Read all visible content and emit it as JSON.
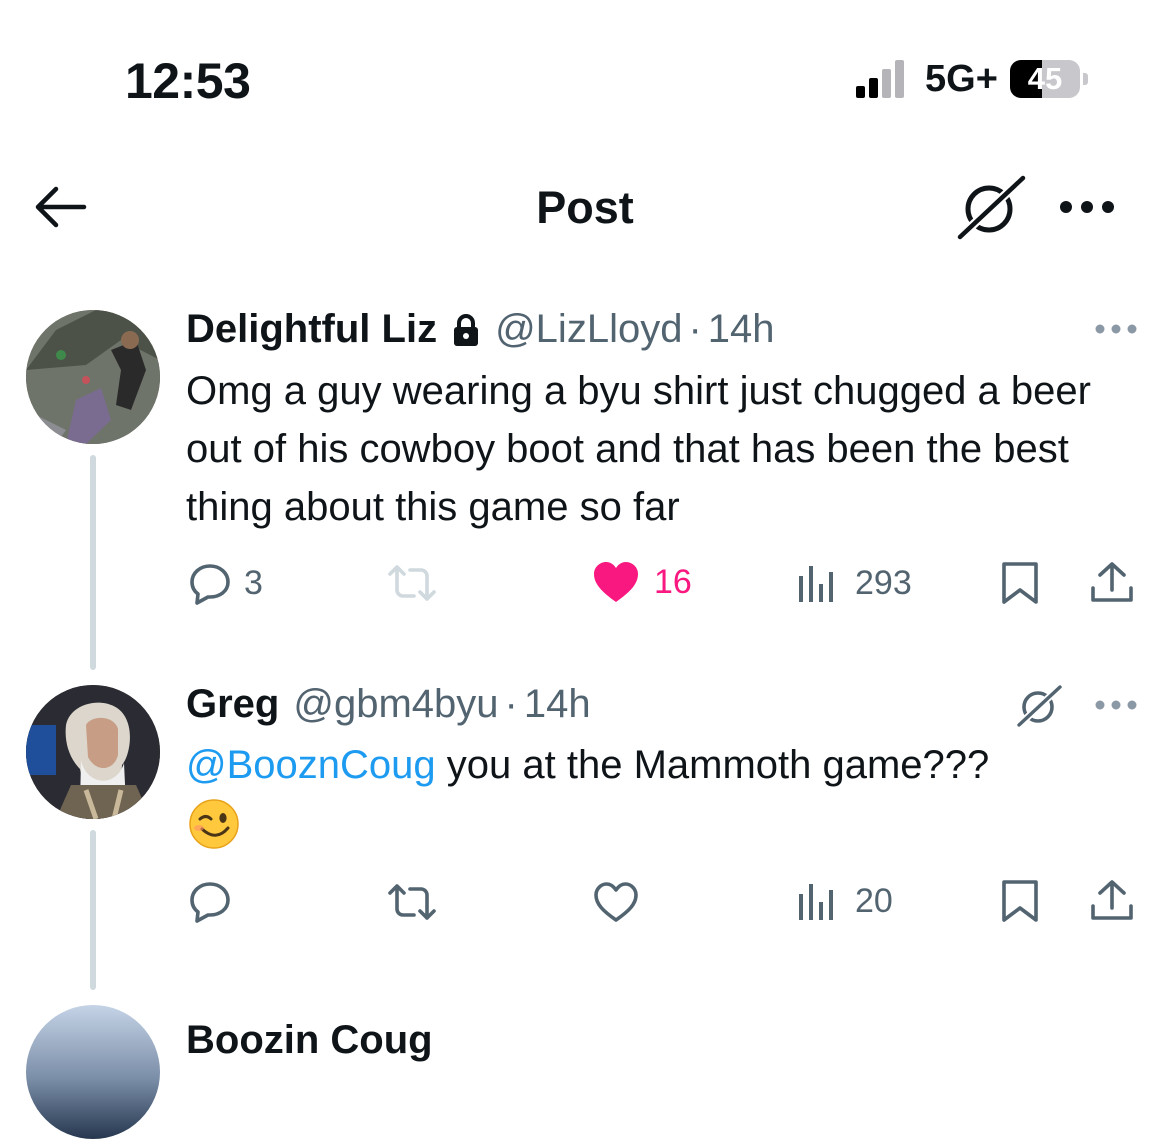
{
  "status_bar": {
    "time": "12:53",
    "network": "5G+",
    "battery": "45",
    "battery_fraction": 0.45
  },
  "header": {
    "title": "Post",
    "back_icon": "arrow-left-icon",
    "grok_icon": "grok-icon",
    "more_icon": "more-horizontal-icon"
  },
  "tweets": [
    {
      "name": "Delightful Liz",
      "protected": true,
      "handle": "@LizLloyd",
      "separator": "·",
      "time": "14h",
      "text": "Omg a guy wearing a byu shirt just chugged a beer out of his cowboy boot and that has been the best thing about this game so far",
      "actions": {
        "replies": "3",
        "reposts": "",
        "likes": "16",
        "liked": true,
        "views": "293"
      }
    },
    {
      "name": "Greg",
      "handle": "@gbm4byu",
      "separator": "·",
      "time": "14h",
      "mention": "@BooznCoug",
      "text": " you at the Mammoth game???",
      "emoji": "😉",
      "actions": {
        "replies": "",
        "reposts": "",
        "likes": "",
        "liked": false,
        "views": "20"
      }
    },
    {
      "name": "Boozin Coug"
    }
  ],
  "colors": {
    "text": "#0f1419",
    "secondary": "#536471",
    "link": "#1d9bf0",
    "like": "#f91880",
    "thread_line": "#cfd9de"
  }
}
